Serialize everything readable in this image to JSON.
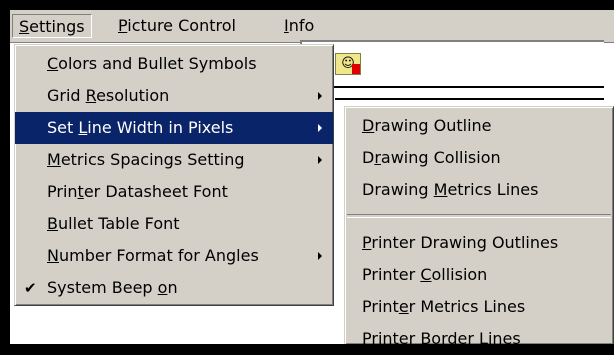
{
  "menubar": {
    "items": [
      {
        "pre": "",
        "key": "S",
        "post": "ettings"
      },
      {
        "pre": "",
        "key": "P",
        "post": "icture Control"
      },
      {
        "pre": "",
        "key": "I",
        "post": "nfo"
      }
    ]
  },
  "settings_menu": {
    "items": [
      {
        "pre": "",
        "key": "C",
        "post": "olors and Bullet Symbols"
      },
      {
        "pre": "Grid ",
        "key": "R",
        "post": "esolution"
      },
      {
        "pre": "Set ",
        "key": "L",
        "post": "ine Width in Pixels"
      },
      {
        "pre": "",
        "key": "M",
        "post": "etrics Spacings Setting"
      },
      {
        "pre": "Prin",
        "key": "t",
        "post": "er Datasheet Font"
      },
      {
        "pre": "",
        "key": "B",
        "post": "ullet Table Font"
      },
      {
        "pre": "",
        "key": "N",
        "post": "umber Format for Angles"
      },
      {
        "pre": "System Beep ",
        "key": "o",
        "post": "n"
      }
    ]
  },
  "line_width_submenu": {
    "items": [
      {
        "pre": "",
        "key": "D",
        "post": "rawing Outline"
      },
      {
        "pre": "D",
        "key": "r",
        "post": "awing Collision"
      },
      {
        "pre": "Drawing ",
        "key": "M",
        "post": "etrics Lines"
      },
      {
        "pre": "",
        "key": "P",
        "post": "rinter Drawing Outlines"
      },
      {
        "pre": "Printer ",
        "key": "C",
        "post": "ollision"
      },
      {
        "pre": "Print",
        "key": "e",
        "post": "r Metrics Lines"
      },
      {
        "pre": "Printer ",
        "key": "B",
        "post": "order Lines"
      }
    ]
  },
  "icons": {
    "toolbar": "bitmap-tool-icon",
    "submenu": "submenu-arrow-icon",
    "check": "checkmark-icon",
    "check_glyph": "✔"
  },
  "colors": {
    "menu_face": "#d4d0c8",
    "highlight": "#0a246a",
    "highlight_text": "#ffffff"
  }
}
